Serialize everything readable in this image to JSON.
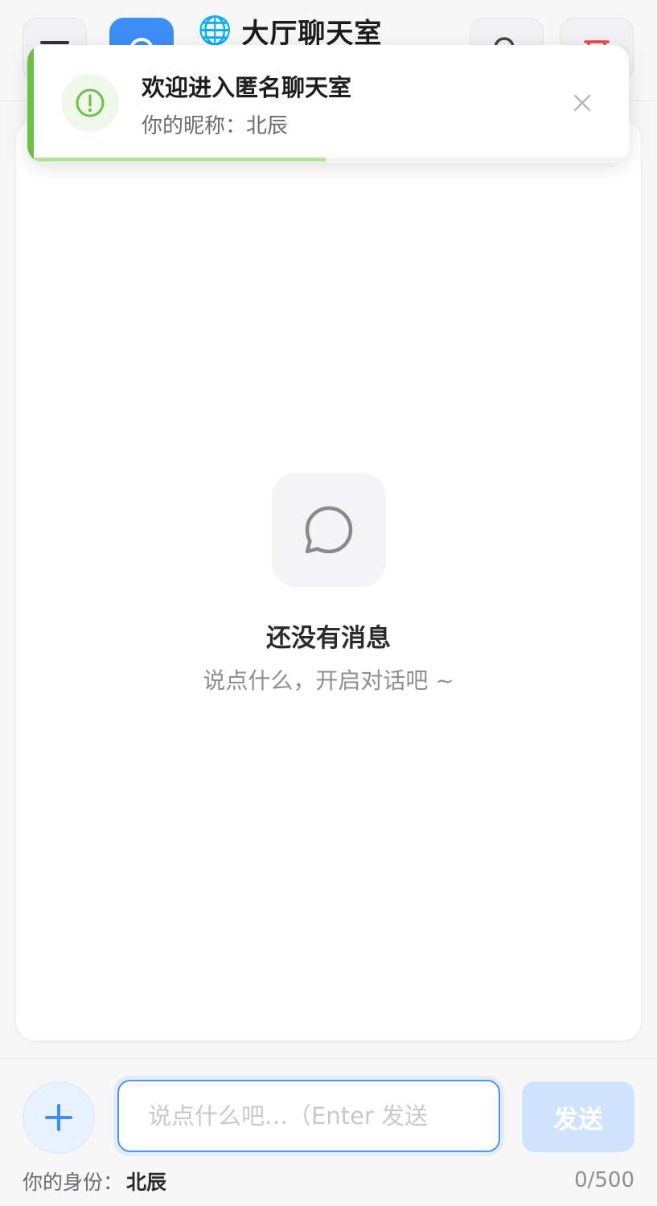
{
  "header": {
    "title": "大厅聊天室",
    "title_emoji": "🌐",
    "icons": [
      "menu-icon",
      "chat-room-icon",
      "search-icon",
      "leave-icon"
    ]
  },
  "toast": {
    "title": "欢迎进入匿名聊天室",
    "body": "你的昵称：北辰",
    "progress_fraction": 0.49,
    "accent_color": "#6cc04a"
  },
  "chat": {
    "empty_title": "还没有消息",
    "empty_subtitle": "说点什么，开启对话吧 ~"
  },
  "composer": {
    "placeholder": "说点什么吧…（Enter 发送",
    "value": "",
    "send_label": "发送",
    "identity_label": "你的身份：",
    "identity_name": "北辰",
    "char_count": "0/500"
  },
  "colors": {
    "primary": "#3d8ff5",
    "success": "#6cc04a",
    "danger": "#e5484d"
  }
}
